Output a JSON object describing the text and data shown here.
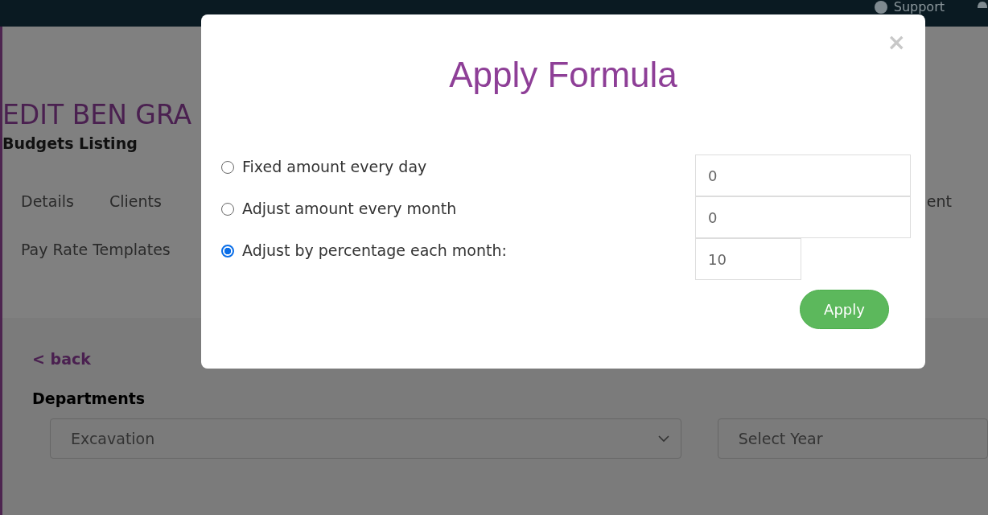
{
  "top_bar": {
    "support": "Support"
  },
  "page": {
    "title": "EDIT BEN GRA",
    "subtitle": "Budgets Listing",
    "tab_rows": [
      [
        "Details",
        "Clients",
        "ent"
      ],
      [
        "Pay Rate Templates"
      ]
    ],
    "back": "< back",
    "departments_label": "Departments",
    "department_select": "Excavation",
    "year_select": {
      "placeholder": "Select Year"
    }
  },
  "modal": {
    "title": "Apply Formula",
    "close": "×",
    "options": [
      {
        "label": "Fixed amount every day",
        "selected": false,
        "value": "0",
        "kind": "amount"
      },
      {
        "label": "Adjust amount every month",
        "selected": false,
        "value": "0",
        "kind": "amount"
      },
      {
        "label": "Adjust by percentage each month:",
        "selected": true,
        "value": "10",
        "kind": "percentage"
      }
    ],
    "apply": "Apply"
  }
}
